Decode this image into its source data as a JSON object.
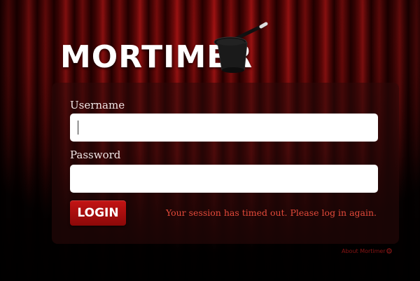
{
  "app": {
    "title": "MORTIMER"
  },
  "form": {
    "username_label": "Username",
    "username_value": "",
    "password_label": "Password",
    "password_value": "",
    "login_button": "LOGIN",
    "session_message": "Your session has timed out. Please log in again."
  },
  "footer": {
    "about_link": "About Mortimer",
    "settings_icon": "gear-icon"
  },
  "colors": {
    "curtain": "#8a0d0d",
    "button": "#b01010",
    "message": "#e44a3a",
    "footer_link": "#8a1414"
  }
}
